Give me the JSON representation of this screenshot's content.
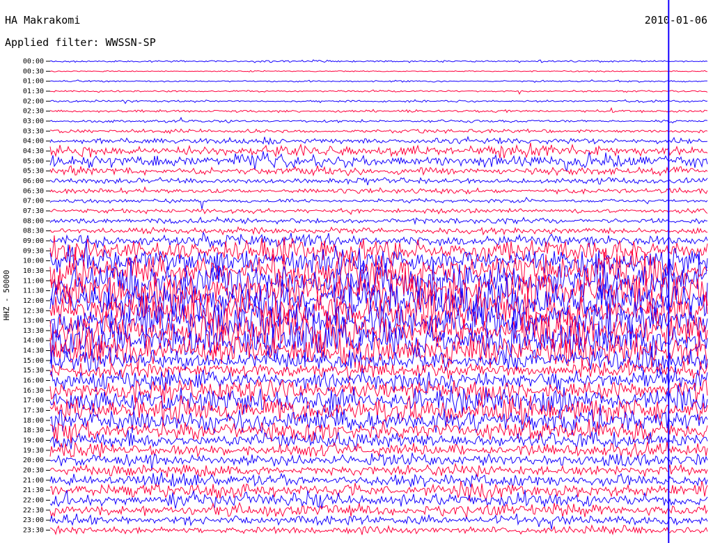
{
  "header": {
    "station": "HA Makrakomi",
    "date": "2010-01-06",
    "filter_label": "Applied filter: WWSSN-SP"
  },
  "channel_label": "HHZ - 50000",
  "chart_data": {
    "type": "line",
    "title": "HA Makrakomi",
    "subtitle": "Applied filter: WWSSN-SP",
    "ylabel": "HHZ - 50000",
    "xlabel": "",
    "categories": [
      "00:00",
      "00:30",
      "01:00",
      "01:30",
      "02:00",
      "02:30",
      "03:00",
      "03:30",
      "04:00",
      "04:30",
      "05:00",
      "05:30",
      "06:00",
      "06:30",
      "07:00",
      "07:30",
      "08:00",
      "08:30",
      "09:00",
      "09:30",
      "10:00",
      "10:30",
      "11:00",
      "11:30",
      "12:00",
      "12:30",
      "13:00",
      "13:30",
      "14:00",
      "14:30",
      "15:00",
      "15:30",
      "16:00",
      "16:30",
      "17:00",
      "17:30",
      "18:00",
      "18:30",
      "19:00",
      "19:30",
      "20:00",
      "20:30",
      "21:00",
      "21:30",
      "22:00",
      "22:30",
      "23:00",
      "23:30"
    ],
    "trace_colors": [
      "#1400ff",
      "#ff003c"
    ],
    "marker_color": "#1400ff",
    "marker_time_fraction": 0.941,
    "trace_relative_amplitude": [
      0.05,
      0.03,
      0.04,
      0.04,
      0.05,
      0.06,
      0.06,
      0.09,
      0.14,
      0.26,
      0.32,
      0.18,
      0.14,
      0.12,
      0.09,
      0.11,
      0.13,
      0.14,
      0.28,
      0.55,
      0.62,
      0.78,
      0.92,
      0.92,
      0.92,
      0.92,
      0.92,
      0.92,
      0.92,
      0.72,
      0.48,
      0.36,
      0.46,
      0.52,
      0.56,
      0.62,
      0.56,
      0.46,
      0.38,
      0.31,
      0.28,
      0.24,
      0.29,
      0.32,
      0.34,
      0.29,
      0.24,
      0.17
    ],
    "grid": false,
    "legend": "none"
  }
}
